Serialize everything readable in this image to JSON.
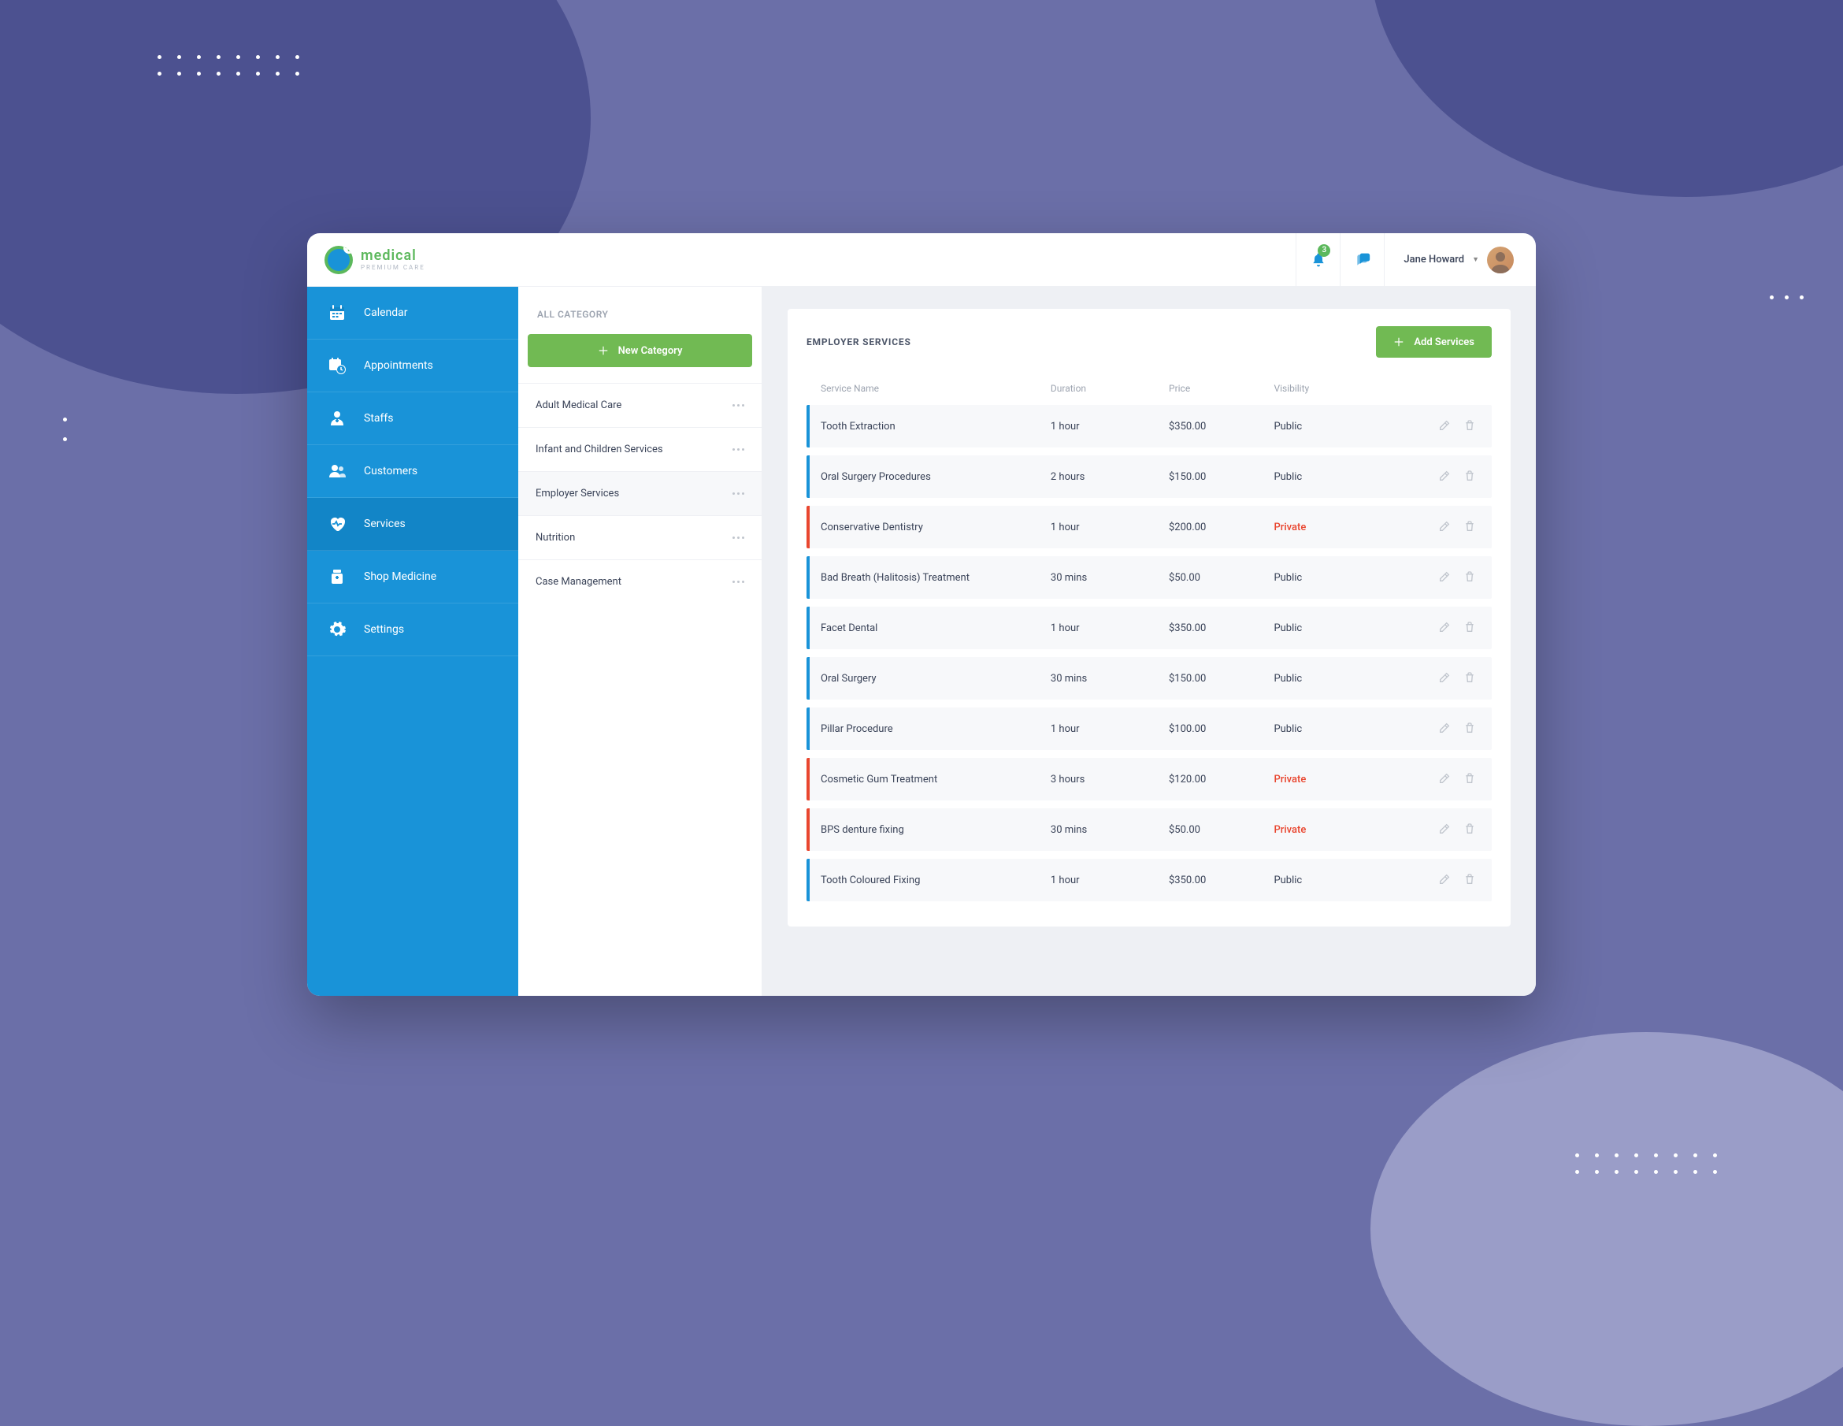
{
  "brand": {
    "title": "medical",
    "subtitle": "PREMIUM CARE"
  },
  "topbar": {
    "notification_count": "3",
    "user_name": "Jane Howard"
  },
  "sidebar": {
    "items": [
      {
        "label": "Calendar",
        "icon": "calendar"
      },
      {
        "label": "Appointments",
        "icon": "calendar-clock"
      },
      {
        "label": "Staffs",
        "icon": "staff"
      },
      {
        "label": "Customers",
        "icon": "users"
      },
      {
        "label": "Services",
        "icon": "heart"
      },
      {
        "label": "Shop Medicine",
        "icon": "medicine"
      },
      {
        "label": "Settings",
        "icon": "gear"
      }
    ],
    "active_index": 4
  },
  "categories": {
    "heading": "ALL CATEGORY",
    "new_button": "New Category",
    "items": [
      {
        "label": "Adult Medical Care"
      },
      {
        "label": "Infant and Children Services"
      },
      {
        "label": "Employer Services"
      },
      {
        "label": "Nutrition"
      },
      {
        "label": "Case Management"
      }
    ],
    "active_index": 2
  },
  "services": {
    "title": "EMPLOYER SERVICES",
    "add_button": "Add Services",
    "columns": {
      "name": "Service Name",
      "duration": "Duration",
      "price": "Price",
      "visibility": "Visibility"
    },
    "rows": [
      {
        "name": "Tooth Extraction",
        "duration": "1 hour",
        "price": "$350.00",
        "visibility": "Public"
      },
      {
        "name": "Oral Surgery Procedures",
        "duration": "2 hours",
        "price": "$150.00",
        "visibility": "Public"
      },
      {
        "name": "Conservative Dentistry",
        "duration": "1 hour",
        "price": "$200.00",
        "visibility": "Private"
      },
      {
        "name": "Bad Breath (Halitosis) Treatment",
        "duration": "30 mins",
        "price": "$50.00",
        "visibility": "Public"
      },
      {
        "name": "Facet Dental",
        "duration": "1 hour",
        "price": "$350.00",
        "visibility": "Public"
      },
      {
        "name": "Oral Surgery",
        "duration": "30 mins",
        "price": "$150.00",
        "visibility": "Public"
      },
      {
        "name": "Pillar Procedure",
        "duration": "1 hour",
        "price": "$100.00",
        "visibility": "Public"
      },
      {
        "name": "Cosmetic Gum Treatment",
        "duration": "3 hours",
        "price": "$120.00",
        "visibility": "Private"
      },
      {
        "name": "BPS denture fixing",
        "duration": "30 mins",
        "price": "$50.00",
        "visibility": "Private"
      },
      {
        "name": "Tooth Coloured Fixing",
        "duration": "1 hour",
        "price": "$350.00",
        "visibility": "Public"
      }
    ]
  }
}
